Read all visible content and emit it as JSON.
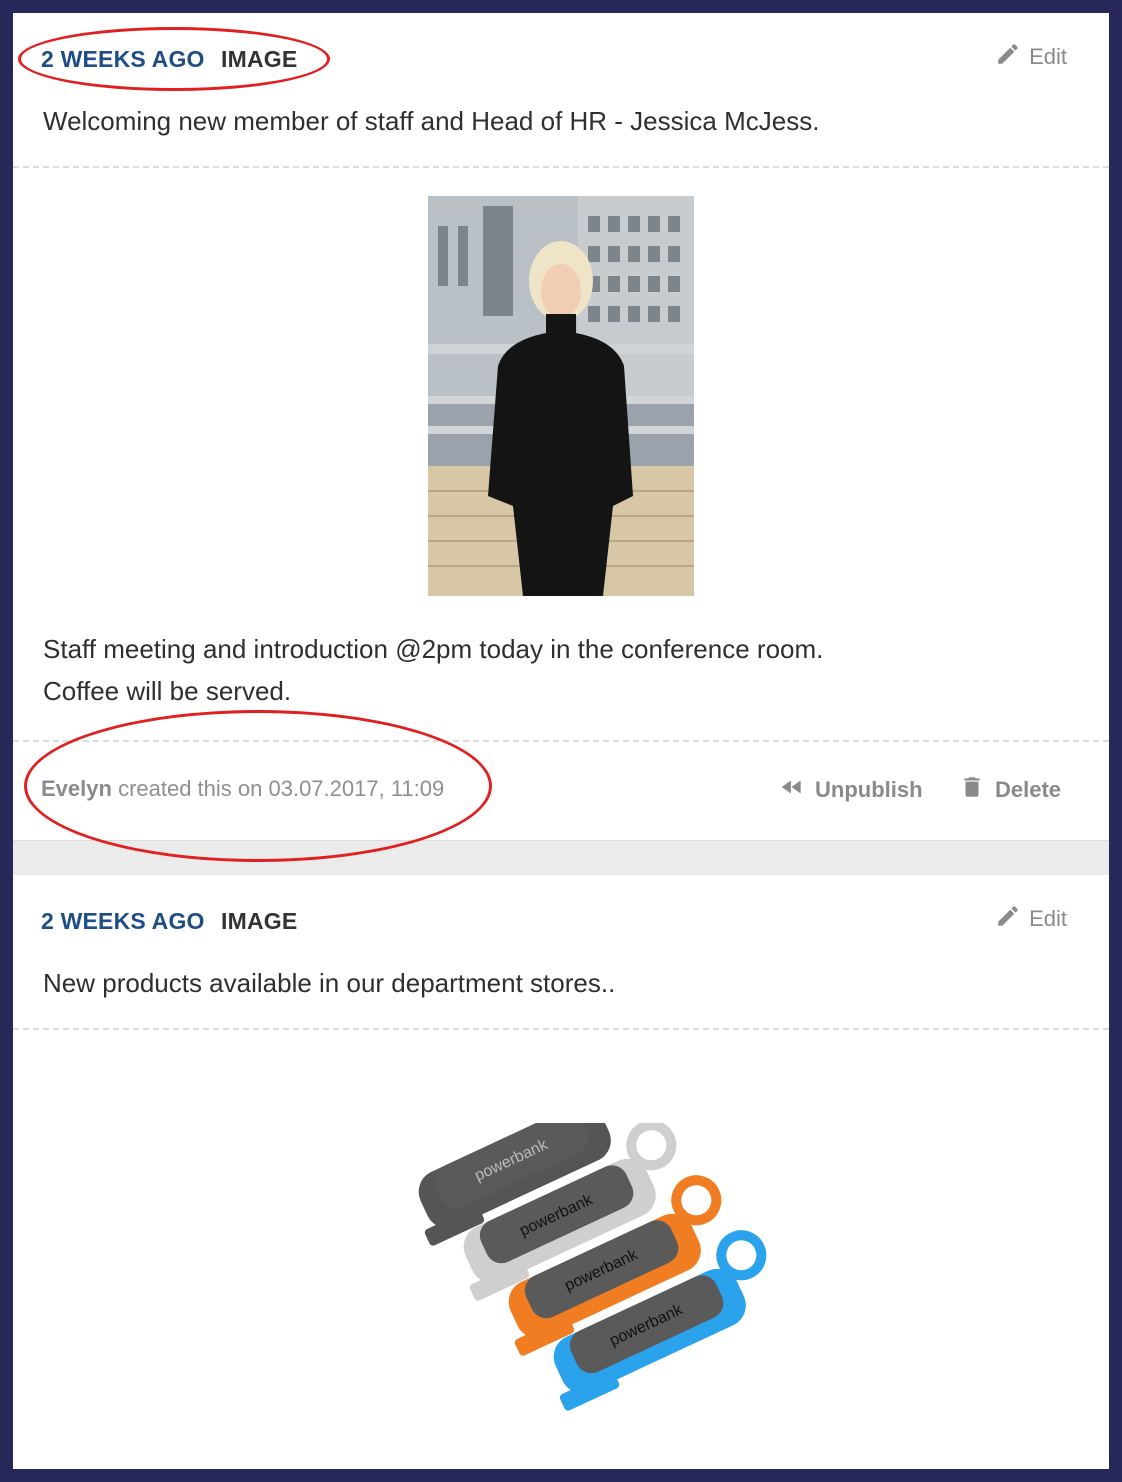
{
  "posts": [
    {
      "time": "2 WEEKS AGO",
      "type": "IMAGE",
      "edit_label": "Edit",
      "title": "Welcoming new member of staff and Head of HR - Jessica McJess.",
      "body_line1": "Staff meeting and introduction @2pm today in the conference room.",
      "body_line2": "Coffee will be served.",
      "author": "Evelyn",
      "created_text": "created this on 03.07.2017, 11:09",
      "unpublish_label": "Unpublish",
      "delete_label": "Delete"
    },
    {
      "time": "2 WEEKS AGO",
      "type": "IMAGE",
      "edit_label": "Edit",
      "title": "New products available in our department stores.."
    }
  ],
  "product_image": {
    "label": "powerbank",
    "colors": [
      "#555555",
      "#cfcfcf",
      "#f07d22",
      "#2aa3ec"
    ]
  },
  "colors": {
    "accent": "#1f4d85",
    "annotation": "#e02020",
    "frame": "#27285a"
  }
}
